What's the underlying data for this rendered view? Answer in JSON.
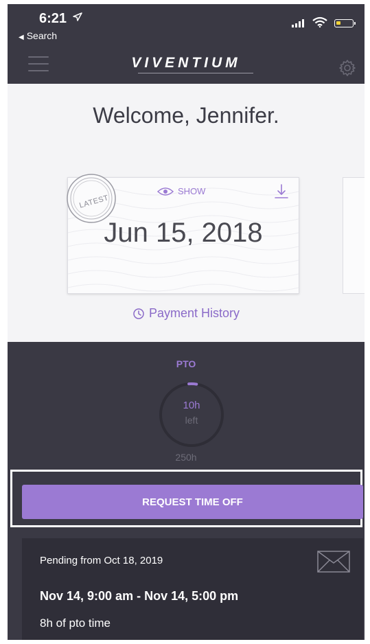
{
  "status_bar": {
    "time": "6:21",
    "back_label": "Search"
  },
  "nav": {
    "logo": "VIVENTIUM"
  },
  "welcome": {
    "title": "Welcome, Jennifer."
  },
  "pay_card": {
    "badge": "LATEST",
    "show_label": "SHOW",
    "date": "Jun 15, 2018"
  },
  "payment_history_label": "Payment History",
  "pto": {
    "label": "PTO",
    "hours_left": "10h",
    "left_label": "left",
    "total": "250h",
    "used_fraction": 0.04
  },
  "request_button_label": "REQUEST TIME OFF",
  "pending": {
    "from": "Pending from Oct 18, 2019",
    "range": "Nov 14, 9:00 am - Nov 14, 5:00 pm",
    "amount": "8h of pto time"
  },
  "colors": {
    "accent": "#9b7ad3",
    "dark_bg": "#3a3944",
    "card_bg": "#2f2e38"
  }
}
